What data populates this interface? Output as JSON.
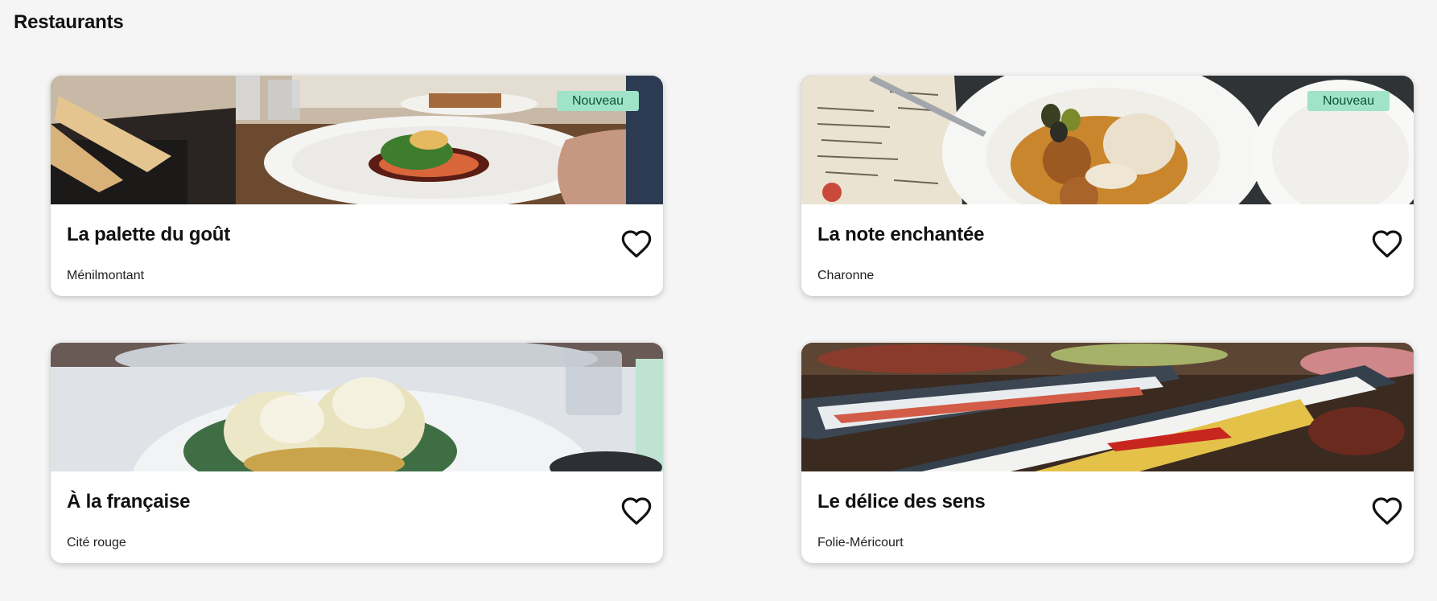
{
  "page": {
    "title": "Restaurants"
  },
  "colors": {
    "background": "#f5f5f5",
    "card": "#ffffff",
    "badge_bg": "#9fe3c9",
    "badge_text": "#0e5135"
  },
  "restaurants": [
    {
      "name": "La palette du goût",
      "district": "Ménilmontant",
      "badge": "Nouveau",
      "favorite_icon": "heart-outline-icon"
    },
    {
      "name": "La note enchantée",
      "district": "Charonne",
      "badge": "Nouveau",
      "favorite_icon": "heart-outline-icon"
    },
    {
      "name": "À la française",
      "district": "Cité rouge",
      "favorite_icon": "heart-outline-icon"
    },
    {
      "name": "Le délice des sens",
      "district": "Folie-Méricourt",
      "favorite_icon": "heart-outline-icon"
    }
  ]
}
